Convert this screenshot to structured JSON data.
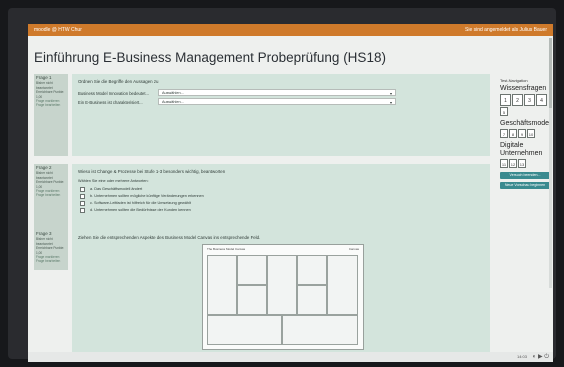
{
  "header": {
    "brand": "moodle @ HTW Chur",
    "login": "Sie sind angemeldet als Julius Bauer"
  },
  "page": {
    "title": "Einführung E-Business Management Probeprüfung (HS18)"
  },
  "questions": [
    {
      "title": "Frage 1",
      "status": "Bisher nicht beantwortet",
      "points": "Erreichbare Punkte: 1,00",
      "flag": "Frage markieren",
      "edit": "Frage bearbeiten",
      "text": "Ordnen Sie die Begriffe den Aussagen zu",
      "rows": [
        {
          "stem": "Business Model Innovation bedeutet...",
          "value": "Auswählen..."
        },
        {
          "stem": "Ein E-Business ist charakterisiert...",
          "value": "Auswählen..."
        }
      ]
    },
    {
      "title": "Frage 2",
      "status": "Bisher nicht beantwortet",
      "points": "Erreichbare Punkte: 1,00",
      "flag": "Frage markieren",
      "edit": "Frage bearbeiten",
      "text": "Wieso ist Change & Prozesse bei Stufe 1-3 besonders wichtig, beantworten",
      "hint": "Wählen Sie eine oder mehrere Antworten:",
      "options": [
        "a. Das Geschäftsmodell ändert",
        "b. Unternehmen sollten mögliche künftige Veränderungen erkennen",
        "c. Software-Leitfaden ist hilfreich für die Umsetzung gewählt",
        "d. Unternehmen sollten die Bedürfnisse der Kunden kennen"
      ]
    },
    {
      "title": "Frage 3",
      "status": "Bisher nicht beantwortet",
      "points": "Erreichbare Punkte: 1,00",
      "flag": "Frage markieren",
      "edit": "Frage bearbeiten",
      "text": "Ziehen Sie die entsprechenden Aspekte des Business Model Canvas ins entsprechende Feld.",
      "canvas_caption": "The Business Model Canvas",
      "canvas_caption_right": "Canvas"
    }
  ],
  "navigation": {
    "title": "Test-Navigation",
    "groups": [
      {
        "name": "Wissensfragen",
        "buttons": [
          "1",
          "2",
          "3",
          "4"
        ],
        "extra": [
          "5"
        ]
      },
      {
        "name": "Geschäftsmodell",
        "buttons": [
          "7",
          "8",
          "9",
          "10"
        ]
      },
      {
        "name": "Digitale Unternehmen",
        "buttons": [
          "11",
          "12",
          "13"
        ]
      }
    ],
    "finish_button": "Versuch beenden...",
    "new_preview": "Neue Vorschau beginnen"
  },
  "taskbar": {
    "clock": "14:03"
  }
}
